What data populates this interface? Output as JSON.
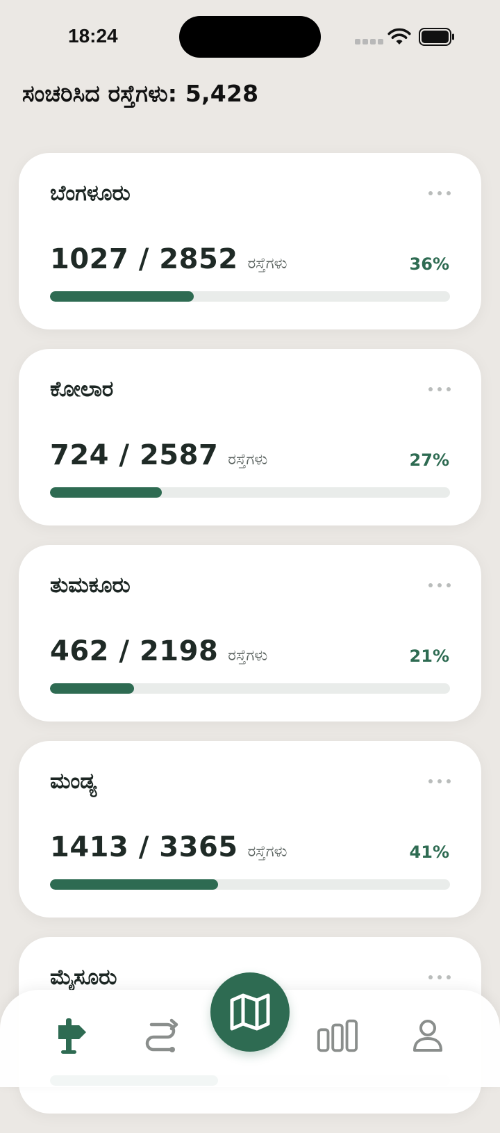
{
  "status_bar": {
    "time": "18:24"
  },
  "header": {
    "title": "ಸಂಚರಿಸಿದ ರಸ್ತೆಗಳು: 5,428"
  },
  "theme": {
    "accent": "#2e6b52",
    "background": "#ebe8e4",
    "card": "#ffffff"
  },
  "cards": [
    {
      "name": "ಬೆಂಗಳೂರು",
      "count": "1027 / 2852",
      "unit": "ರಸ್ತೆಗಳು",
      "percent": "36%",
      "progress": 0.36
    },
    {
      "name": "ಕೋಲಾರ",
      "count": "724 / 2587",
      "unit": "ರಸ್ತೆಗಳು",
      "percent": "27%",
      "progress": 0.28
    },
    {
      "name": "ತುಮಕೂರು",
      "count": "462 / 2198",
      "unit": "ರಸ್ತೆಗಳು",
      "percent": "21%",
      "progress": 0.21
    },
    {
      "name": "ಮಂಡ್ಯ",
      "count": "1413 / 3365",
      "unit": "ರಸ್ತೆಗಳು",
      "percent": "41%",
      "progress": 0.42
    },
    {
      "name": "ಮೈಸೂರು",
      "count": "",
      "unit": "",
      "percent": "",
      "progress": 0.42
    }
  ],
  "bottom_nav": {
    "items": [
      {
        "icon": "signpost-icon",
        "active": true
      },
      {
        "icon": "route-icon",
        "active": false
      },
      {
        "icon": "map-icon",
        "active": false,
        "primary": true
      },
      {
        "icon": "bar-chart-icon",
        "active": false
      },
      {
        "icon": "profile-icon",
        "active": false
      }
    ]
  }
}
